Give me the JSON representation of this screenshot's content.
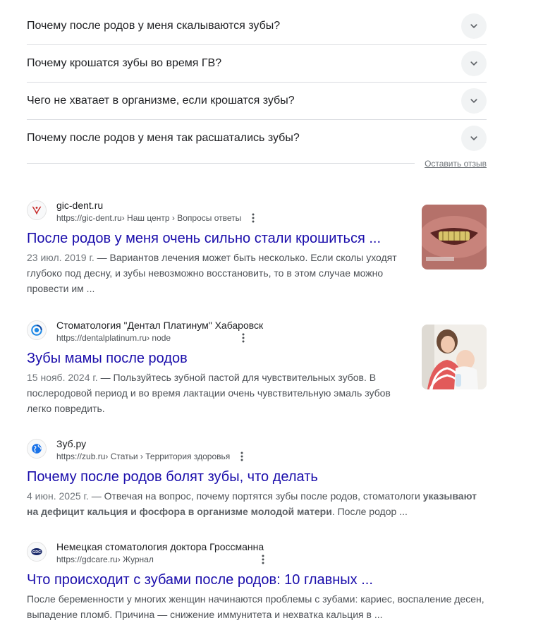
{
  "paa": {
    "questions": [
      "Почему после родов у меня скалываются зубы?",
      "Почему крошатся зубы во время ГВ?",
      "Чего не хватает в организме, если крошатся зубы?",
      "Почему после родов у меня так расшатались зубы?"
    ],
    "feedback": "Оставить отзыв"
  },
  "results": [
    {
      "site": "gic-dent.ru",
      "url": "https://gic-dent.ru",
      "path": " › Наш центр › Вопросы ответы",
      "title": "После родов у меня очень сильно стали крошиться ...",
      "date": "23 июл. 2019 г.",
      "snippet": " — Вариантов лечения может быть несколько. Если сколы уходят глубоко под десну, и зубы невозможно восстановить, то в этом случае можно провести им ..."
    },
    {
      "site": "Стоматология \"Дентал Платинум\" Хабаровск",
      "url": "https://dentalplatinum.ru",
      "path": " › node",
      "title": "Зубы мамы после родов",
      "date": "15 нояб. 2024 г.",
      "snippet": " — Пользуйтесь зубной пастой для чувствительных зубов. В послеродовой период и во время лактации очень чувствительную эмаль зубов легко повредить."
    },
    {
      "site": "Зуб.ру",
      "url": "https://zub.ru",
      "path": " › Статьи › Территория здоровья",
      "title": "Почему после родов болят зубы, что делать",
      "date": "4 июн. 2025 г.",
      "snippet_a": " — Отвечая на вопрос, почему портятся зубы после родов, стоматологи ",
      "snippet_bold": "указывают на дефицит кальция и фосфора в организме молодой матери",
      "snippet_b": ". После родор ..."
    },
    {
      "site": "Немецкая стоматология доктора Гроссманна",
      "url": "https://gdcare.ru",
      "path": " › Журнал",
      "title": "Что происходит с зубами после родов: 10 главных ...",
      "snippet": "После беременности у многих женщин начинаются проблемы с зубами: кариес, воспаление десен, выпадение пломб. Причина — снижение иммунитета и нехватка кальция в ..."
    }
  ],
  "favicons": [
    "gic-dent-logo-icon",
    "dentalplatinum-logo-icon",
    "globe-icon",
    "gdc-logo-icon"
  ],
  "favicon_text": "GDC",
  "colors": {
    "link": "#1a0dab",
    "text": "#202124",
    "muted": "#4d5156",
    "divider": "#dadce0"
  }
}
